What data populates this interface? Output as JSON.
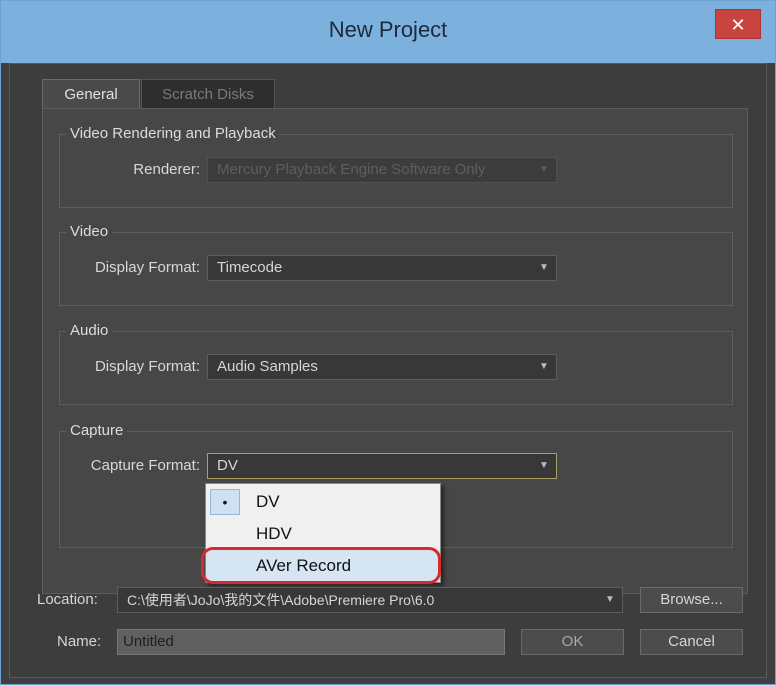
{
  "window": {
    "title": "New Project",
    "close_glyph": "✕"
  },
  "tabs": [
    {
      "label": "General",
      "active": true
    },
    {
      "label": "Scratch Disks",
      "active": false
    }
  ],
  "groups": {
    "rendering": {
      "title": "Video Rendering and Playback",
      "renderer_label": "Renderer:",
      "renderer_value": "Mercury Playback Engine Software Only",
      "disabled": true
    },
    "video": {
      "title": "Video",
      "display_format_label": "Display Format:",
      "display_format_value": "Timecode"
    },
    "audio": {
      "title": "Audio",
      "display_format_label": "Display Format:",
      "display_format_value": "Audio Samples"
    },
    "capture": {
      "title": "Capture",
      "capture_format_label": "Capture Format:",
      "capture_format_value": "DV"
    }
  },
  "capture_menu": {
    "items": [
      {
        "label": "DV",
        "selected": true,
        "bullet": "•"
      },
      {
        "label": "HDV",
        "selected": false
      },
      {
        "label": "AVer Record",
        "selected": false,
        "highlighted": true
      }
    ],
    "annotation_color": "#d62b2b"
  },
  "location": {
    "label": "Location:",
    "value": "C:\\使用者\\JoJo\\我的文件\\Adobe\\Premiere Pro\\6.0",
    "browse_label": "Browse..."
  },
  "name": {
    "label": "Name:",
    "value": "Untitled"
  },
  "buttons": {
    "ok": "OK",
    "cancel": "Cancel"
  },
  "icons": {
    "dropdown_arrow": "chevron-down-icon",
    "close": "close-icon"
  },
  "colors": {
    "titlebar": "#7db1dd",
    "dialog_bg": "#3d3d3d",
    "close": "#c8453f"
  }
}
